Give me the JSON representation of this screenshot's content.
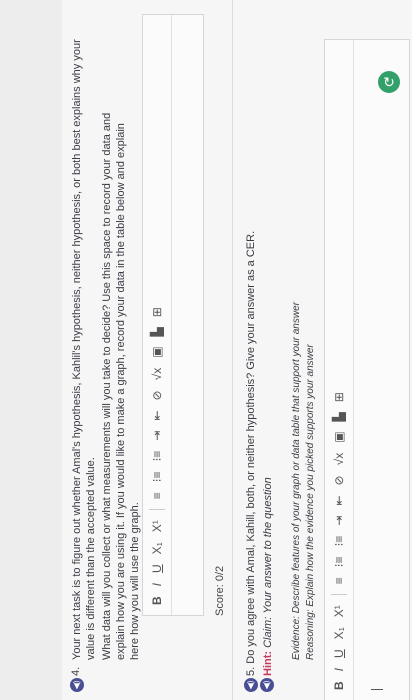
{
  "q4": {
    "number": "4.",
    "prompt": "Your next task is to figure out whether Amal's hypothesis, Kahlil's hypothesis, neither hypothesis, or both best explains why your value is different than the accepted value.",
    "detail": "What data will you collect or what measurements will you take to decide? Use this space to record your data and explain how you are using it. If you would like to make a graph, record your data in the table below and explain here how you will use the graph."
  },
  "toolbar": {
    "bold": "B",
    "italic": "I",
    "underline": "U",
    "subscript": "X₁",
    "superscript": "X¹",
    "align": "≡",
    "ordered_list": "⁝≡",
    "bullet_list": "⁝≡",
    "indent": "⇥",
    "outdent": "⇤",
    "link": "⊘",
    "math": "√x",
    "image": "▣",
    "chart": "▙",
    "table": "⊞"
  },
  "score": "Score: 0/2",
  "q5": {
    "number": "5.",
    "prompt": "Do you agree with Amal, Kahill, both, or neither hypothesis? Give your answer as a CER."
  },
  "hint": {
    "label": "Hint:",
    "claim_label": "Claim:",
    "claim": "Your answer to the question",
    "evidence_label": "Evidence:",
    "evidence": "Describe features of your graph or data table that support your answer",
    "reasoning_label": "Reasoning:",
    "reasoning": "Explain how the evidence you picked supports your answer"
  },
  "colors": {
    "speaker": "#4a4f93",
    "hint": "#c63b5f",
    "refresh": "#33a06a"
  }
}
